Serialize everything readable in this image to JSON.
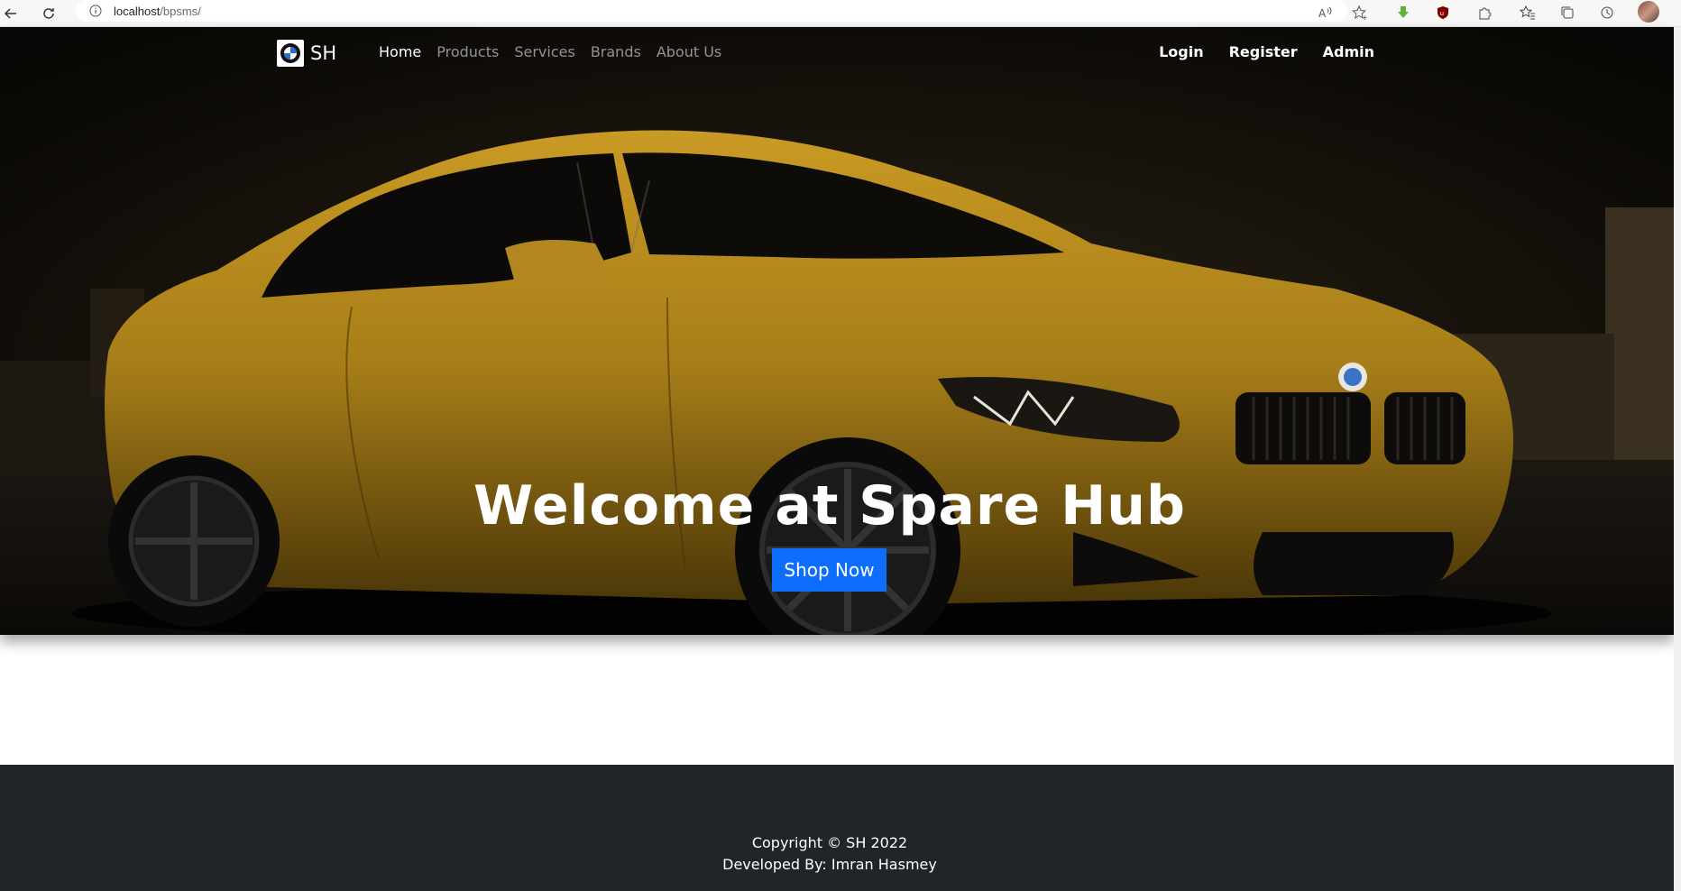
{
  "browser": {
    "url_host": "localhost",
    "url_path": "/bpsms/"
  },
  "navbar": {
    "brand": "SH",
    "links": [
      {
        "label": "Home",
        "active": true
      },
      {
        "label": "Products",
        "active": false
      },
      {
        "label": "Services",
        "active": false
      },
      {
        "label": "Brands",
        "active": false
      },
      {
        "label": "About Us",
        "active": false
      }
    ],
    "right": [
      "Login",
      "Register",
      "Admin"
    ]
  },
  "hero": {
    "title": "Welcome at Spare Hub",
    "button": "Shop Now"
  },
  "footer": {
    "copyright": "Copyright © SH 2022",
    "developer": "Developed By: Imran Hasmey"
  },
  "colors": {
    "primary_button": "#0d6efd",
    "footer_bg": "#212529",
    "car_body": "#b38a1e"
  }
}
